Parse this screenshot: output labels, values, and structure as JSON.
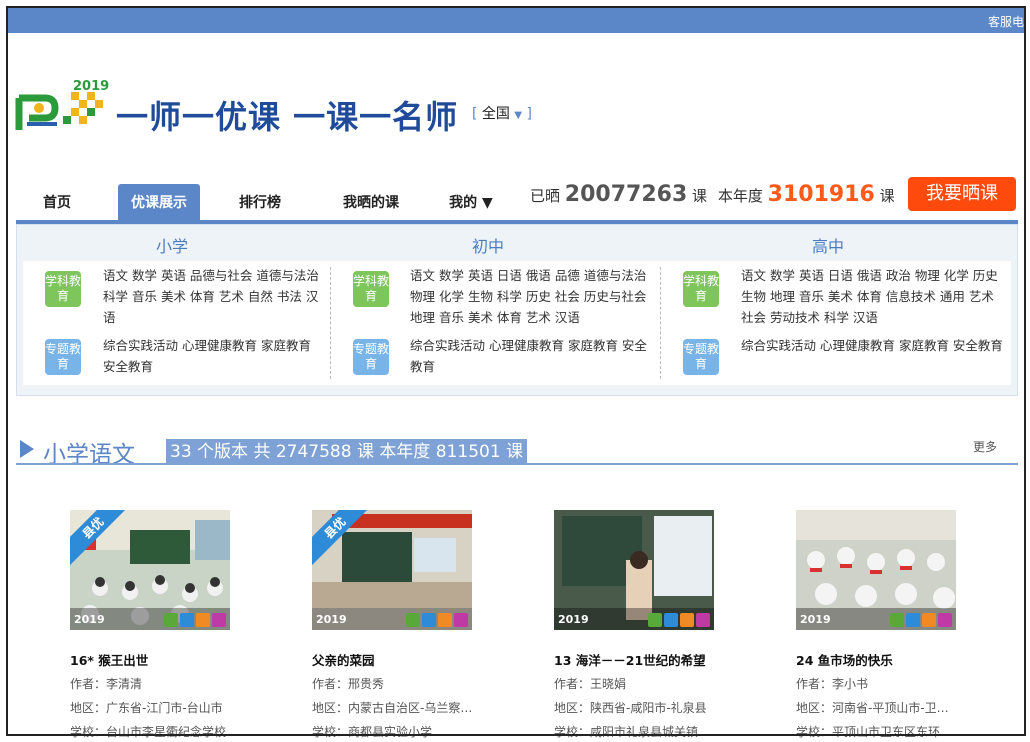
{
  "topbar": {
    "service_text": "客服电话"
  },
  "header": {
    "logo_year": "2019",
    "slogan": "一师一优课 一课一名师",
    "region": "全国"
  },
  "nav": {
    "items": [
      {
        "label": "首页"
      },
      {
        "label": "优课展示"
      },
      {
        "label": "排行榜"
      },
      {
        "label": "我晒的课"
      },
      {
        "label": "我的 ▼"
      }
    ]
  },
  "stats": {
    "prefix": "已晒",
    "total": "20077263",
    "unit1": "课",
    "year_label": "本年度",
    "year_total": "3101916",
    "unit2": "课",
    "cta": "我要晒课"
  },
  "categories": {
    "columns": [
      {
        "title": "小学",
        "subject_tag": "学科教育",
        "subjects": "语文 数学 英语 品德与社会 道德与法治 科学 音乐 美术 体育 艺术 自然 书法 汉语",
        "topic_tag": "专题教育",
        "topics": "综合实践活动 心理健康教育 家庭教育 安全教育"
      },
      {
        "title": "初中",
        "subject_tag": "学科教育",
        "subjects": "语文 数学 英语 日语 俄语 品德 道德与法治 物理 化学 生物 科学 历史 社会 历史与社会 地理 音乐 美术 体育 艺术 汉语",
        "topic_tag": "专题教育",
        "topics": "综合实践活动 心理健康教育 家庭教育 安全教育"
      },
      {
        "title": "高中",
        "subject_tag": "学科教育",
        "subjects": "语文 数学 英语 日语 俄语 政治 物理 化学 历史 生物 地理 音乐 美术 体育 信息技术 通用 艺术 社会 劳动技术 科学 汉语",
        "topic_tag": "专题教育",
        "topics": "综合实践活动 心理健康教育 家庭教育 安全教育"
      }
    ]
  },
  "section": {
    "title": "小学语文",
    "stats": "33 个版本 共 2747588 课 本年度 811501 课",
    "more": "更多"
  },
  "cards": [
    {
      "title": "16* 猴王出世",
      "author": "作者：李清清",
      "region": "地区：广东省-江门市-台山市",
      "school": "学校：台山市李星衢纪念学校",
      "year": "2019",
      "badge": "县优"
    },
    {
      "title": "父亲的菜园",
      "author": "作者：邢贵秀",
      "region": "地区：内蒙古自治区-乌兰察…",
      "school": "学校：商都县实验小学",
      "year": "2019",
      "badge": "县优"
    },
    {
      "title": "13 海洋－－21世纪的希望",
      "author": "作者：王晓娟",
      "region": "地区：陕西省-咸阳市-礼泉县",
      "school": "学校：咸阳市礼泉县城关镇…",
      "year": "2019",
      "badge": ""
    },
    {
      "title": "24 鱼市场的快乐",
      "author": "作者：李小书",
      "region": "地区：河南省-平顶山市-卫…",
      "school": "学校：平顶山市卫东区东环…",
      "year": "2019",
      "badge": ""
    }
  ],
  "colors": {
    "brand_blue": "#5b86c7",
    "cta_orange": "#ff4a0d",
    "highlight_orange": "#ff5a1a",
    "tag_green": "#7ec55b",
    "tag_blue": "#78b4e8"
  }
}
